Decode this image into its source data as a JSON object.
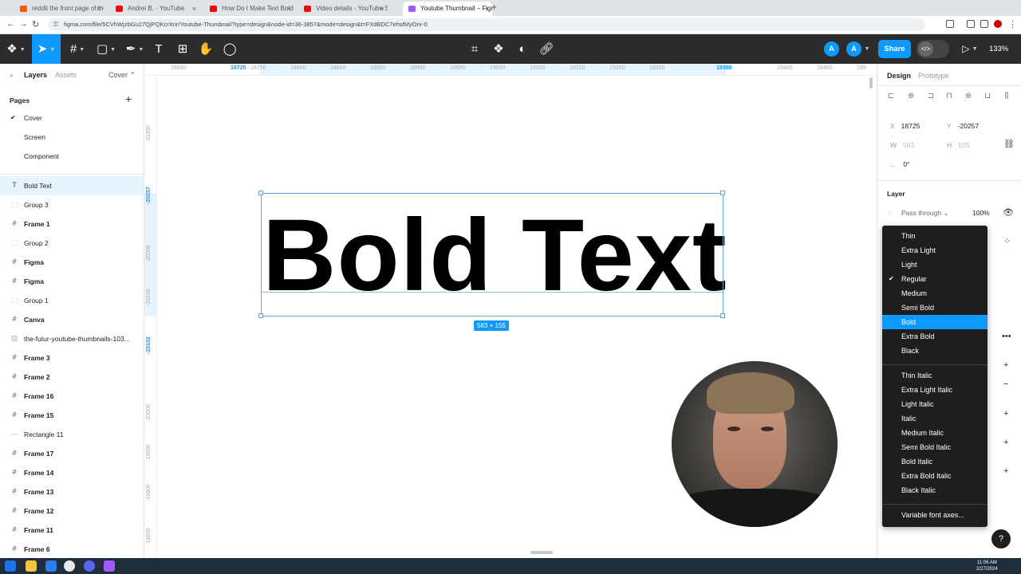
{
  "browser": {
    "tabs": [
      {
        "title": "reddit the front page of the int",
        "color": "#ff5700"
      },
      {
        "title": "Andrei B. - YouTube",
        "color": "#ff0000"
      },
      {
        "title": "How Do I Make Text Bold in Fig",
        "color": "#ff0000"
      },
      {
        "title": "Video details - YouTube Studio",
        "color": "#ff0000"
      },
      {
        "title": "Youtube Thumbnail – Figma",
        "color": "#a259ff"
      }
    ],
    "new_tab": "+",
    "url": "figma.com/file/5CVhWjzbGu27QjPQKcrXnr/Youtube-Thumbnail?type=design&node-id=36-3857&mode=design&t=FXdBDC7ehsfMyOnr-0"
  },
  "toolbar": {
    "zoom": "133%",
    "share_label": "Share",
    "avatar1": "A",
    "avatar2": "A",
    "accent": "#0d99ff"
  },
  "left_panel": {
    "tab_layers": "Layers",
    "tab_assets": "Assets",
    "page_selector": "Cover ⌃",
    "pages_title": "Pages",
    "pages": [
      "Cover",
      "Screen",
      "Component"
    ],
    "layers": [
      {
        "name": "Bold Text",
        "icon": "T"
      },
      {
        "name": "Group 3",
        "icon": "⬚"
      },
      {
        "name": "Frame 1",
        "icon": "#"
      },
      {
        "name": "Group 2",
        "icon": "⬚"
      },
      {
        "name": "Figma",
        "icon": "#"
      },
      {
        "name": "Figma",
        "icon": "#"
      },
      {
        "name": "Group 1",
        "icon": "⬚"
      },
      {
        "name": "Canva",
        "icon": "#"
      },
      {
        "name": "the-futur-youtube-thumbnails-103...",
        "icon": "▨"
      },
      {
        "name": "Frame 3",
        "icon": "#"
      },
      {
        "name": "Frame 2",
        "icon": "#"
      },
      {
        "name": "Frame 16",
        "icon": "#"
      },
      {
        "name": "Frame 15",
        "icon": "#"
      },
      {
        "name": "Rectangle 11",
        "icon": "—"
      },
      {
        "name": "Frame 17",
        "icon": "#"
      },
      {
        "name": "Frame 14",
        "icon": "#"
      },
      {
        "name": "Frame 13",
        "icon": "#"
      },
      {
        "name": "Frame 12",
        "icon": "#"
      },
      {
        "name": "Frame 11",
        "icon": "#"
      },
      {
        "name": "Frame 6",
        "icon": "#"
      }
    ]
  },
  "ruler": {
    "top": [
      "18650",
      "18725",
      "18750",
      "18800",
      "18850",
      "18900",
      "18950",
      "19000",
      "19050",
      "19100",
      "19150",
      "19200",
      "19250",
      "19308",
      "19400",
      "19450",
      "195"
    ],
    "left": [
      "-20350",
      "-20257",
      "-20200",
      "-20150",
      "-20102",
      "-20000",
      "-19950",
      "-19900",
      "-19850",
      "-19800"
    ]
  },
  "canvas": {
    "text": "Bold Text",
    "size_badge": "583 × 155"
  },
  "right_panel": {
    "tab_design": "Design",
    "tab_prototype": "Prototype",
    "x_label": "X",
    "x": "18725",
    "y_label": "Y",
    "y": "-20257",
    "w_label": "W",
    "w": "583",
    "h_label": "H",
    "h": "155",
    "rotation": "0°",
    "layer_title": "Layer",
    "blend": "Pass through ⌄",
    "opacity": "100%"
  },
  "font_weight_menu": {
    "weights": [
      "Thin",
      "Extra Light",
      "Light",
      "Regular",
      "Medium",
      "Semi Bold",
      "Bold",
      "Extra Bold",
      "Black"
    ],
    "italics": [
      "Thin Italic",
      "Extra Light Italic",
      "Light Italic",
      "Italic",
      "Medium Italic",
      "Semi Bold Italic",
      "Bold Italic",
      "Extra Bold Italic",
      "Black Italic"
    ],
    "checked": "Regular",
    "highlighted": "Bold",
    "variable_axes": "Variable font axes..."
  },
  "help": "?",
  "taskbar": {
    "time": "11:06 AM",
    "date": "2/27/2024"
  }
}
